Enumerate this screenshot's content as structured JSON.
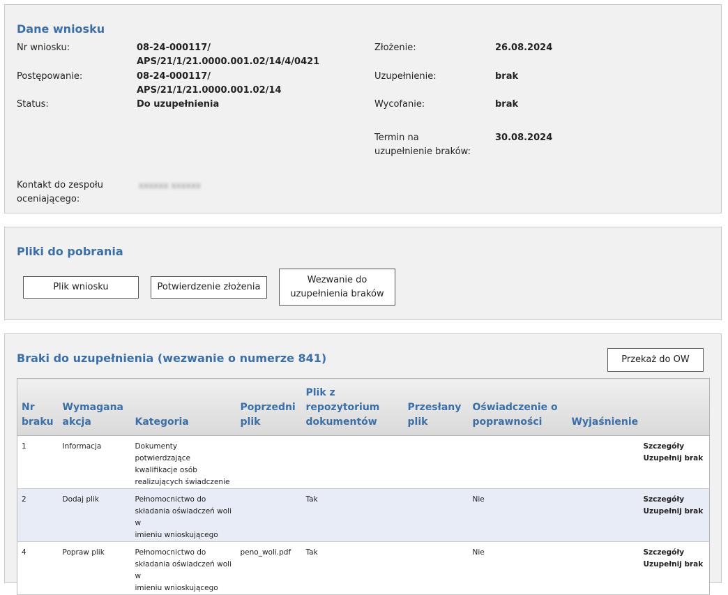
{
  "dane": {
    "title": "Dane wniosku",
    "nr_label": "Nr wniosku:",
    "nr_value_1": "08-24-000117/",
    "nr_value_2": "APS/21/1/21.0000.001.02/14/4/0421",
    "post_label": "Postępowanie:",
    "post_value_1": "08-24-000117/",
    "post_value_2": "APS/21/1/21.0000.001.02/14",
    "status_label": "Status:",
    "status_value": "Do uzupełnienia",
    "zlozenie_label": "Złożenie:",
    "zlozenie_value": "26.08.2024",
    "uzup_label": "Uzupełnienie:",
    "uzup_value": "brak",
    "wycof_label": "Wycofanie:",
    "wycof_value": "brak",
    "termin_label_1": "Termin na",
    "termin_label_2": "uzupełnienie braków:",
    "termin_value": "30.08.2024",
    "kontakt_label_1": "Kontakt do zespołu",
    "kontakt_label_2": "oceniającego:",
    "kontakt_value": "xxxxxx xxxxxx"
  },
  "pliki": {
    "title": "Pliki do pobrania",
    "btn_plik": "Plik wniosku",
    "btn_potw": "Potwierdzenie złożenia",
    "btn_wezw_1": "Wezwanie do",
    "btn_wezw_2": "uzupełnienia braków"
  },
  "braki": {
    "title": "Braki do uzupełnienia (wezwanie o numerze 841)",
    "btn_przekaz": "Przekaż do OW",
    "headers": {
      "nr_1": "Nr",
      "nr_2": "braku",
      "akcja_1": "Wymagana",
      "akcja_2": "akcja",
      "kategoria": "Kategoria",
      "poprz_1": "Poprzedni",
      "poprz_2": "plik",
      "repo_1": "Plik z",
      "repo_2": "repozytorium",
      "repo_3": "dokumentów",
      "przes_1": "Przesłany",
      "przes_2": "plik",
      "osw_1": "Oświadczenie o",
      "osw_2": "poprawności",
      "wyj": "Wyjaśnienie"
    },
    "rows": [
      {
        "nr": "1",
        "akcja": "Informacja",
        "kat_1": "Dokumenty potwierdzające",
        "kat_2": "kwalifikacje osób",
        "kat_3": "realizujących świadczenie",
        "poprz": "",
        "repo": "",
        "przes": "",
        "osw": "",
        "wyj": "",
        "szczegoly": "Szczegóły",
        "uzupelnij": "Uzupełnij brak"
      },
      {
        "nr": "2",
        "akcja": "Dodaj plik",
        "kat_1": "Pełnomocnictwo do",
        "kat_2": "składania oświadczeń woli w",
        "kat_3": "imieniu wnioskującego",
        "poprz": "",
        "repo": "Tak",
        "przes": "",
        "osw": "Nie",
        "wyj": "",
        "szczegoly": "Szczegóły",
        "uzupelnij": "Uzupełnij brak"
      },
      {
        "nr": "4",
        "akcja": "Popraw plik",
        "kat_1": "Pełnomocnictwo do",
        "kat_2": "składania oświadczeń woli w",
        "kat_3": "imieniu wnioskującego",
        "poprz": "peno_woli.pdf",
        "repo": "Tak",
        "przes": "",
        "osw": "Nie",
        "wyj": "",
        "szczegoly": "Szczegóły",
        "uzupelnij": "Uzupełnij brak"
      }
    ]
  },
  "colors": {
    "title_blue": "#3a6fa7",
    "panel_bg": "#f2f1f2",
    "row_alt": "#e7ecf6"
  }
}
